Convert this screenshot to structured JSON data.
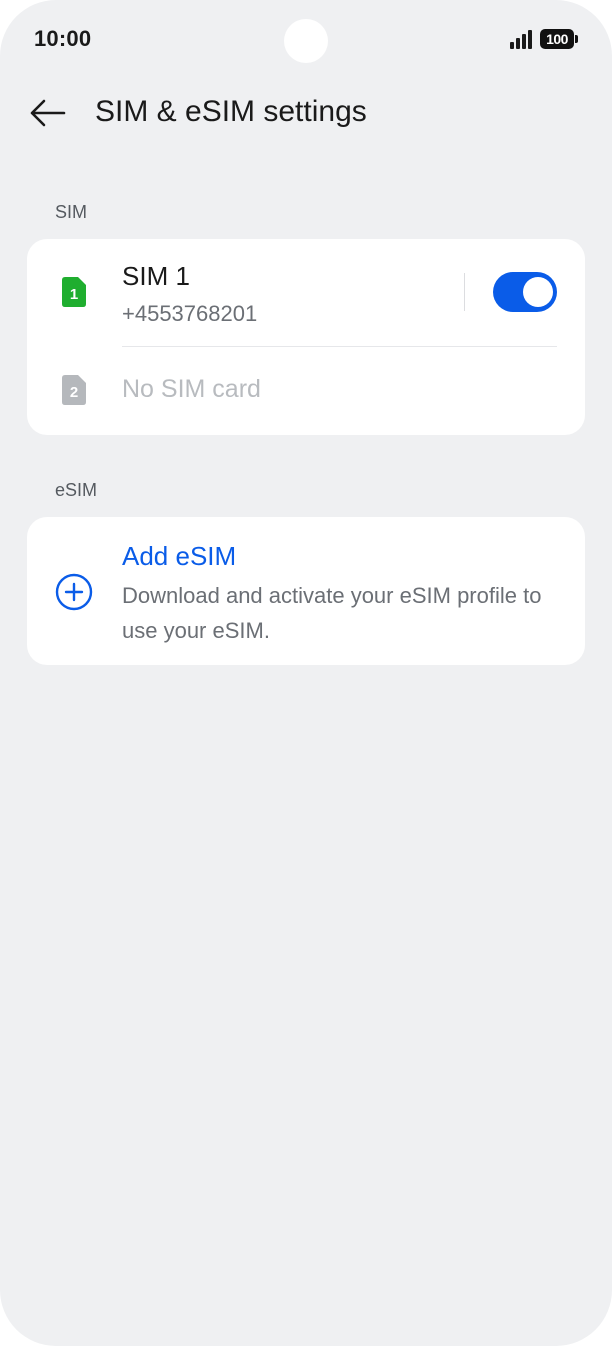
{
  "status_bar": {
    "time": "10:00",
    "battery": "100",
    "icons": [
      "signal-icon",
      "battery-icon"
    ]
  },
  "header": {
    "back_icon": "arrow-left-icon",
    "title": "SIM & eSIM settings"
  },
  "sim_section": {
    "label": "SIM",
    "sim1": {
      "title": "SIM 1",
      "number": "+4553768201",
      "slot_badge": "1",
      "icon": "sim-card-icon",
      "icon_color": "#1fae2f",
      "enabled": true
    },
    "sim2": {
      "title": "No SIM card",
      "slot_badge": "2",
      "icon": "sim-card-icon",
      "icon_color": "#b5b8bc"
    }
  },
  "esim_section": {
    "label": "eSIM",
    "add": {
      "icon": "plus-circle-icon",
      "title": "Add eSIM",
      "description": "Download and activate your eSIM profile to use your eSIM."
    }
  },
  "colors": {
    "accent": "#0a5ce8",
    "background": "#eff0f2",
    "card": "#ffffff"
  }
}
